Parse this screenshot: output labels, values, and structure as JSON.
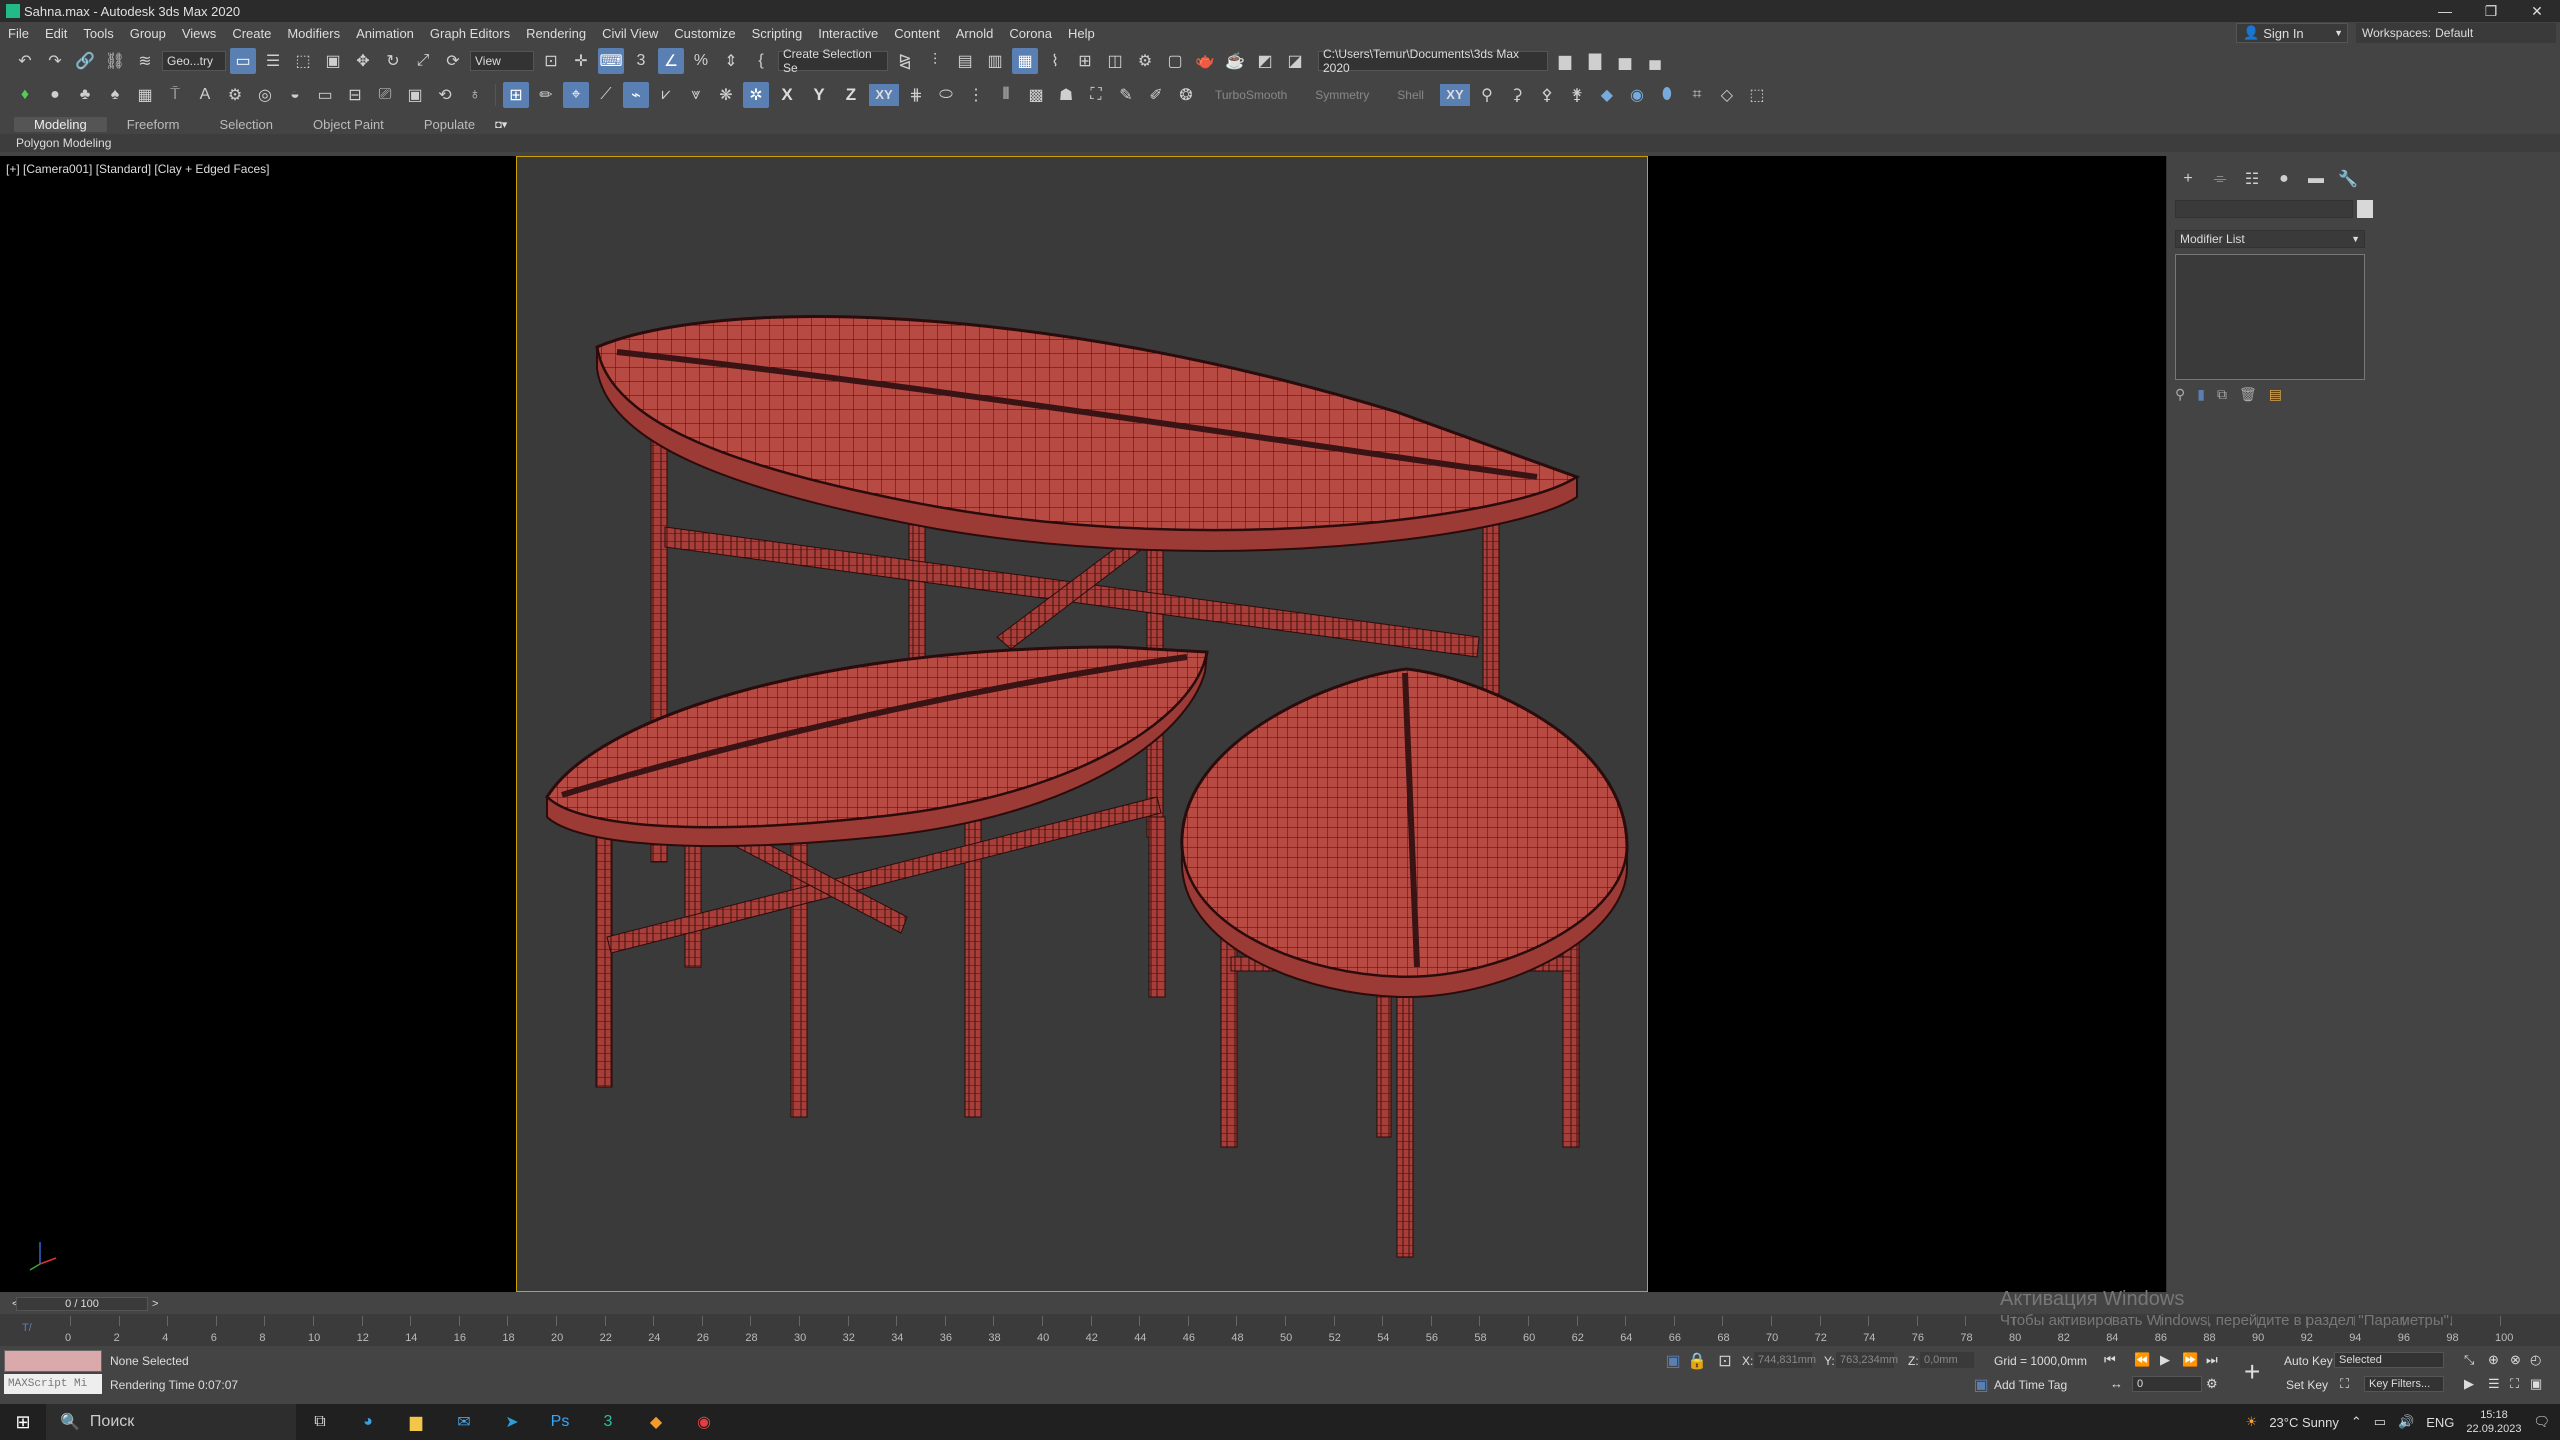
{
  "window": {
    "title": "Sahna.max - Autodesk 3ds Max 2020",
    "buttons": [
      "—",
      "❐",
      "✕"
    ]
  },
  "menu": {
    "items": [
      "File",
      "Edit",
      "Tools",
      "Group",
      "Views",
      "Create",
      "Modifiers",
      "Animation",
      "Graph Editors",
      "Rendering",
      "Civil View",
      "Customize",
      "Scripting",
      "Interactive",
      "Content",
      "Arnold",
      "Corona",
      "Help"
    ],
    "sign_in": "Sign In",
    "workspaces_label": "Workspaces:",
    "workspaces_value": "Default"
  },
  "toolbar1": {
    "selection_filter": "Geo...try",
    "ref_coord": "View",
    "named_selection": "Create Selection Se",
    "project_path": "C:\\Users\\Temur\\Documents\\3ds Max 2020"
  },
  "toolbar2": {
    "turbosmooth": "TurboSmooth",
    "symmetry": "Symmetry",
    "shell": "Shell",
    "x": "X",
    "y": "Y",
    "z": "Z",
    "xy": "XY",
    "xy2": "XY"
  },
  "ribbon": {
    "tabs": [
      "Modeling",
      "Freeform",
      "Selection",
      "Object Paint",
      "Populate"
    ],
    "active_tab": "Modeling",
    "panel_label": "Polygon Modeling"
  },
  "viewport": {
    "label": "[+] [Camera001] [Standard] [Clay + Edged Faces]"
  },
  "command_panel": {
    "modifier_list": "Modifier List"
  },
  "timeline": {
    "slider_text": "0 / 100",
    "ticks": [
      "0",
      "2",
      "4",
      "6",
      "8",
      "10",
      "12",
      "14",
      "16",
      "18",
      "20",
      "22",
      "24",
      "26",
      "28",
      "30",
      "32",
      "34",
      "36",
      "38",
      "40",
      "42",
      "44",
      "46",
      "48",
      "50",
      "52",
      "54",
      "56",
      "58",
      "60",
      "62",
      "64",
      "66",
      "68",
      "70",
      "72",
      "74",
      "76",
      "78",
      "80",
      "82",
      "84",
      "86",
      "88",
      "90",
      "92",
      "94",
      "96",
      "98",
      "100"
    ]
  },
  "status": {
    "maxscript": "MAXScript Mi",
    "selection": "None Selected",
    "render_time": "Rendering Time  0:07:07",
    "x_label": "X:",
    "x_value": "744,831mm",
    "y_label": "Y:",
    "y_value": "763,234mm",
    "z_label": "Z:",
    "z_value": "0,0mm",
    "grid": "Grid = 1000,0mm",
    "add_time_tag": "Add Time Tag",
    "auto_key": "Auto Key",
    "set_key": "Set Key",
    "key_mode": "Selected",
    "key_filters": "Key Filters...",
    "frame": "0"
  },
  "activation": {
    "title": "Активация Windows",
    "text": "Чтобы активировать Windows, перейдите в раздел \"Параметры\"."
  },
  "taskbar": {
    "search": "Поиск",
    "weather": "23°C  Sunny",
    "lang": "ENG",
    "time": "15:18",
    "date": "22.09.2023"
  },
  "colors": {
    "wire": "#3a1414",
    "clay": "#b84a44",
    "clay_light": "#d66a60",
    "frame": "#c8a000",
    "accent": "#5a7fb3"
  }
}
